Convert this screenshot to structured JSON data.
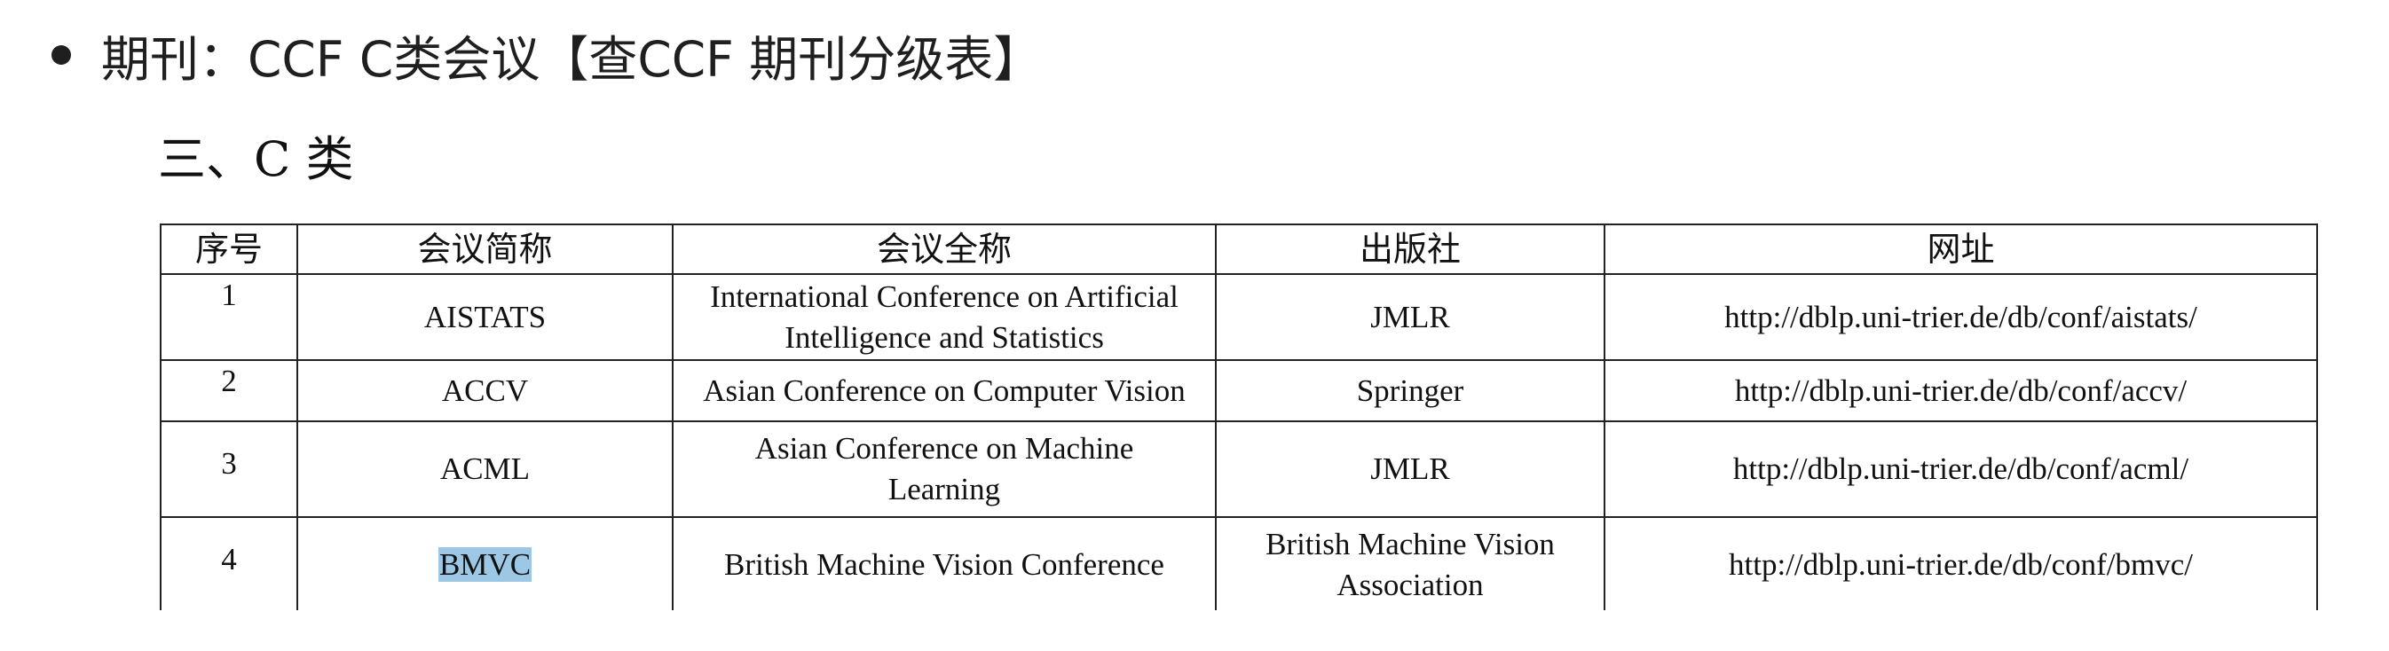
{
  "bullet": {
    "text": "期刊：CCF C类会议【查CCF 期刊分级表】"
  },
  "heading": {
    "text": "三、C 类"
  },
  "table": {
    "headers": [
      "序号",
      "会议简称",
      "会议全称",
      "出版社",
      "网址"
    ],
    "rows": [
      {
        "no": "1",
        "abbr": "AISTATS",
        "fullname_lines": [
          "International Conference on Artificial",
          "Intelligence and Statistics"
        ],
        "publisher_lines": [
          "JMLR"
        ],
        "url": "http://dblp.uni-trier.de/db/conf/aistats/"
      },
      {
        "no": "2",
        "abbr": "ACCV",
        "fullname_lines": [
          "Asian Conference on Computer Vision"
        ],
        "publisher_lines": [
          "Springer"
        ],
        "url": "http://dblp.uni-trier.de/db/conf/accv/"
      },
      {
        "no": "3",
        "abbr": "ACML",
        "fullname_lines": [
          "Asian Conference on Machine",
          "Learning"
        ],
        "publisher_lines": [
          "JMLR"
        ],
        "url": "http://dblp.uni-trier.de/db/conf/acml/"
      },
      {
        "no": "4",
        "abbr": "BMVC",
        "abbr_highlighted": true,
        "fullname_lines": [
          "British Machine Vision Conference"
        ],
        "publisher_lines": [
          "British Machine Vision",
          "Association"
        ],
        "url": "http://dblp.uni-trier.de/db/conf/bmvc/"
      }
    ]
  },
  "colors": {
    "highlight": "#9cc8e6",
    "border": "#222222",
    "text": "#111111"
  }
}
